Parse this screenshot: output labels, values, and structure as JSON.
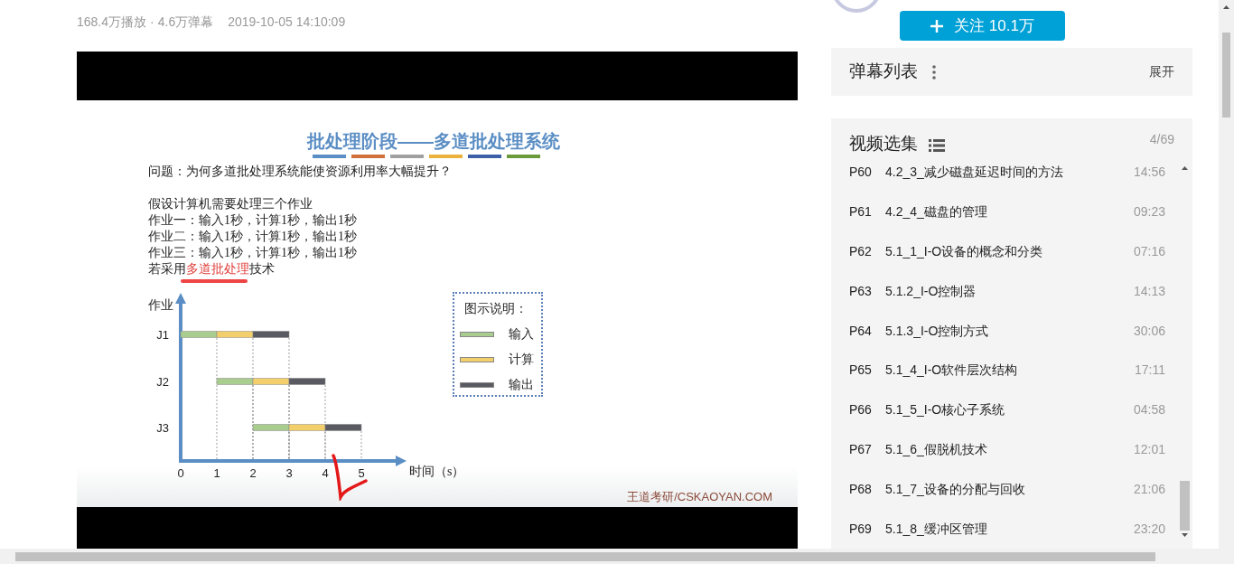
{
  "stats": {
    "plays": "168.4万播放",
    "separator": "·",
    "danmaku": "4.6万弹幕",
    "date": "2019-10-05 14:10:09"
  },
  "slide": {
    "title": "批处理阶段——多道批处理系统",
    "question": "问题：为何多道批处理系统能使资源利用率大幅提升？",
    "lines": [
      "假设计算机需要处理三个作业",
      "作业一：输入1秒，计算1秒，输出1秒",
      "作业二：输入1秒，计算1秒，输出1秒",
      "作业三：输入1秒，计算1秒，输出1秒"
    ],
    "last_line": {
      "before": "若采用",
      "highlight": "多道批处理",
      "after": "技术"
    },
    "diagram": {
      "y_label": "作业",
      "x_label": "时间（s）",
      "x_ticks": [
        "0",
        "1",
        "2",
        "3",
        "4",
        "5"
      ],
      "jobs": [
        {
          "label": "J1"
        },
        {
          "label": "J2"
        },
        {
          "label": "J3"
        }
      ]
    },
    "legend": {
      "title": "图示说明：",
      "items": [
        {
          "label": "输入",
          "color": "#a9cc8f"
        },
        {
          "label": "计算",
          "color": "#f3cf6c"
        },
        {
          "label": "输出",
          "color": "#5a5a62"
        }
      ]
    },
    "footer": "王道考研/CSKAOYAN.COM"
  },
  "follow_button": {
    "label": "关注 10.1万"
  },
  "danmaku_panel": {
    "title": "弹幕列表",
    "expand": "展开"
  },
  "playlist": {
    "title": "视频选集",
    "count": "4/69",
    "items": [
      {
        "part": "P60",
        "title": "4.2_3_减少磁盘延迟时间的方法",
        "duration": "14:56"
      },
      {
        "part": "P61",
        "title": "4.2_4_磁盘的管理",
        "duration": "09:23"
      },
      {
        "part": "P62",
        "title": "5.1_1_I-O设备的概念和分类",
        "duration": "07:16"
      },
      {
        "part": "P63",
        "title": "5.1.2_I-O控制器",
        "duration": "14:13"
      },
      {
        "part": "P64",
        "title": "5.1.3_I-O控制方式",
        "duration": "30:06"
      },
      {
        "part": "P65",
        "title": "5.1_4_I-O软件层次结构",
        "duration": "17:11"
      },
      {
        "part": "P66",
        "title": "5.1_5_I-O核心子系统",
        "duration": "04:58"
      },
      {
        "part": "P67",
        "title": "5.1_6_假脱机技术",
        "duration": "12:01"
      },
      {
        "part": "P68",
        "title": "5.1_7_设备的分配与回收",
        "duration": "21:06"
      },
      {
        "part": "P69",
        "title": "5.1_8_缓冲区管理",
        "duration": "23:20"
      }
    ]
  }
}
